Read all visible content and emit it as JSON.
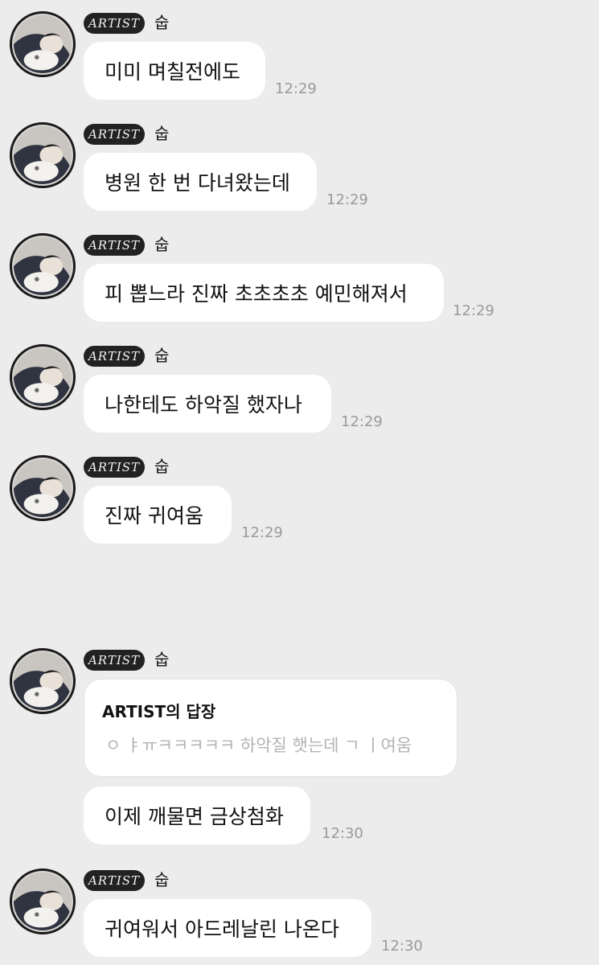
{
  "badge_label": "ARTIST",
  "messages": [
    {
      "sender": "숩",
      "text": "미미 며칠전에도",
      "time": "12:29"
    },
    {
      "sender": "숩",
      "text": "병원 한 번 다녀왔는데",
      "time": "12:29"
    },
    {
      "sender": "숩",
      "text": "피 뽑느라 진짜 초초초초 예민해져서",
      "time": "12:29"
    },
    {
      "sender": "숩",
      "text": "나한테도 하악질 했자나",
      "time": "12:29"
    },
    {
      "sender": "숩",
      "text": "진짜 귀여움",
      "time": "12:29"
    },
    {
      "sender": "숩",
      "reply_title": "ARTIST의 답장",
      "reply_quote": "ㅇ ㅑㅠㅋㅋㅋㅋㅋ 하악질 햇는데 ㄱ ㅣ여움",
      "text": "이제 깨물면 금상첨화",
      "time": "12:30"
    },
    {
      "sender": "숩",
      "text": "귀여워서 아드레날린 나온다",
      "time": "12:30"
    }
  ]
}
